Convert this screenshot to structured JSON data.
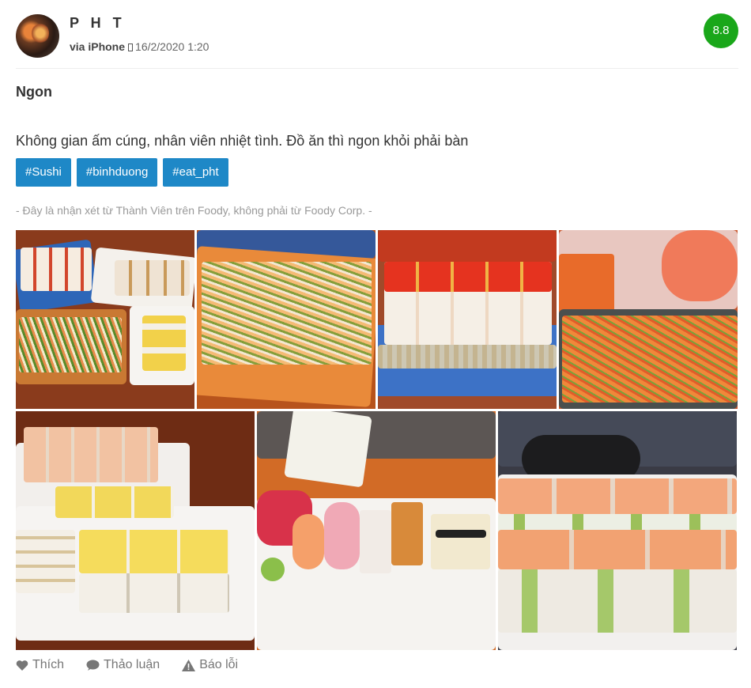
{
  "review": {
    "username": "P H T",
    "device": "via iPhone",
    "date": "16/2/2020 1:20",
    "score": "8.8",
    "title": "Ngon",
    "body": "Không gian ấm cúng, nhân viên nhiệt tình. Đồ ăn thì ngon khỏi phải bàn",
    "tags": [
      "#Sushi",
      "#binhduong",
      "#eat_pht"
    ],
    "disclaimer": "- Đây là nhận xét từ Thành Viên trên Foody, không phải từ Foody Corp. -"
  },
  "photos_count": 7,
  "actions": {
    "like": "Thích",
    "discuss": "Thảo luận",
    "report": "Báo lỗi"
  },
  "colors": {
    "score_bg": "#1aa71a",
    "tag_bg": "#1e88c7",
    "meta_text": "#666666",
    "disclaimer_text": "#999999"
  },
  "icons": [
    "phone-icon",
    "heart-icon",
    "comment-icon",
    "warning-icon"
  ]
}
